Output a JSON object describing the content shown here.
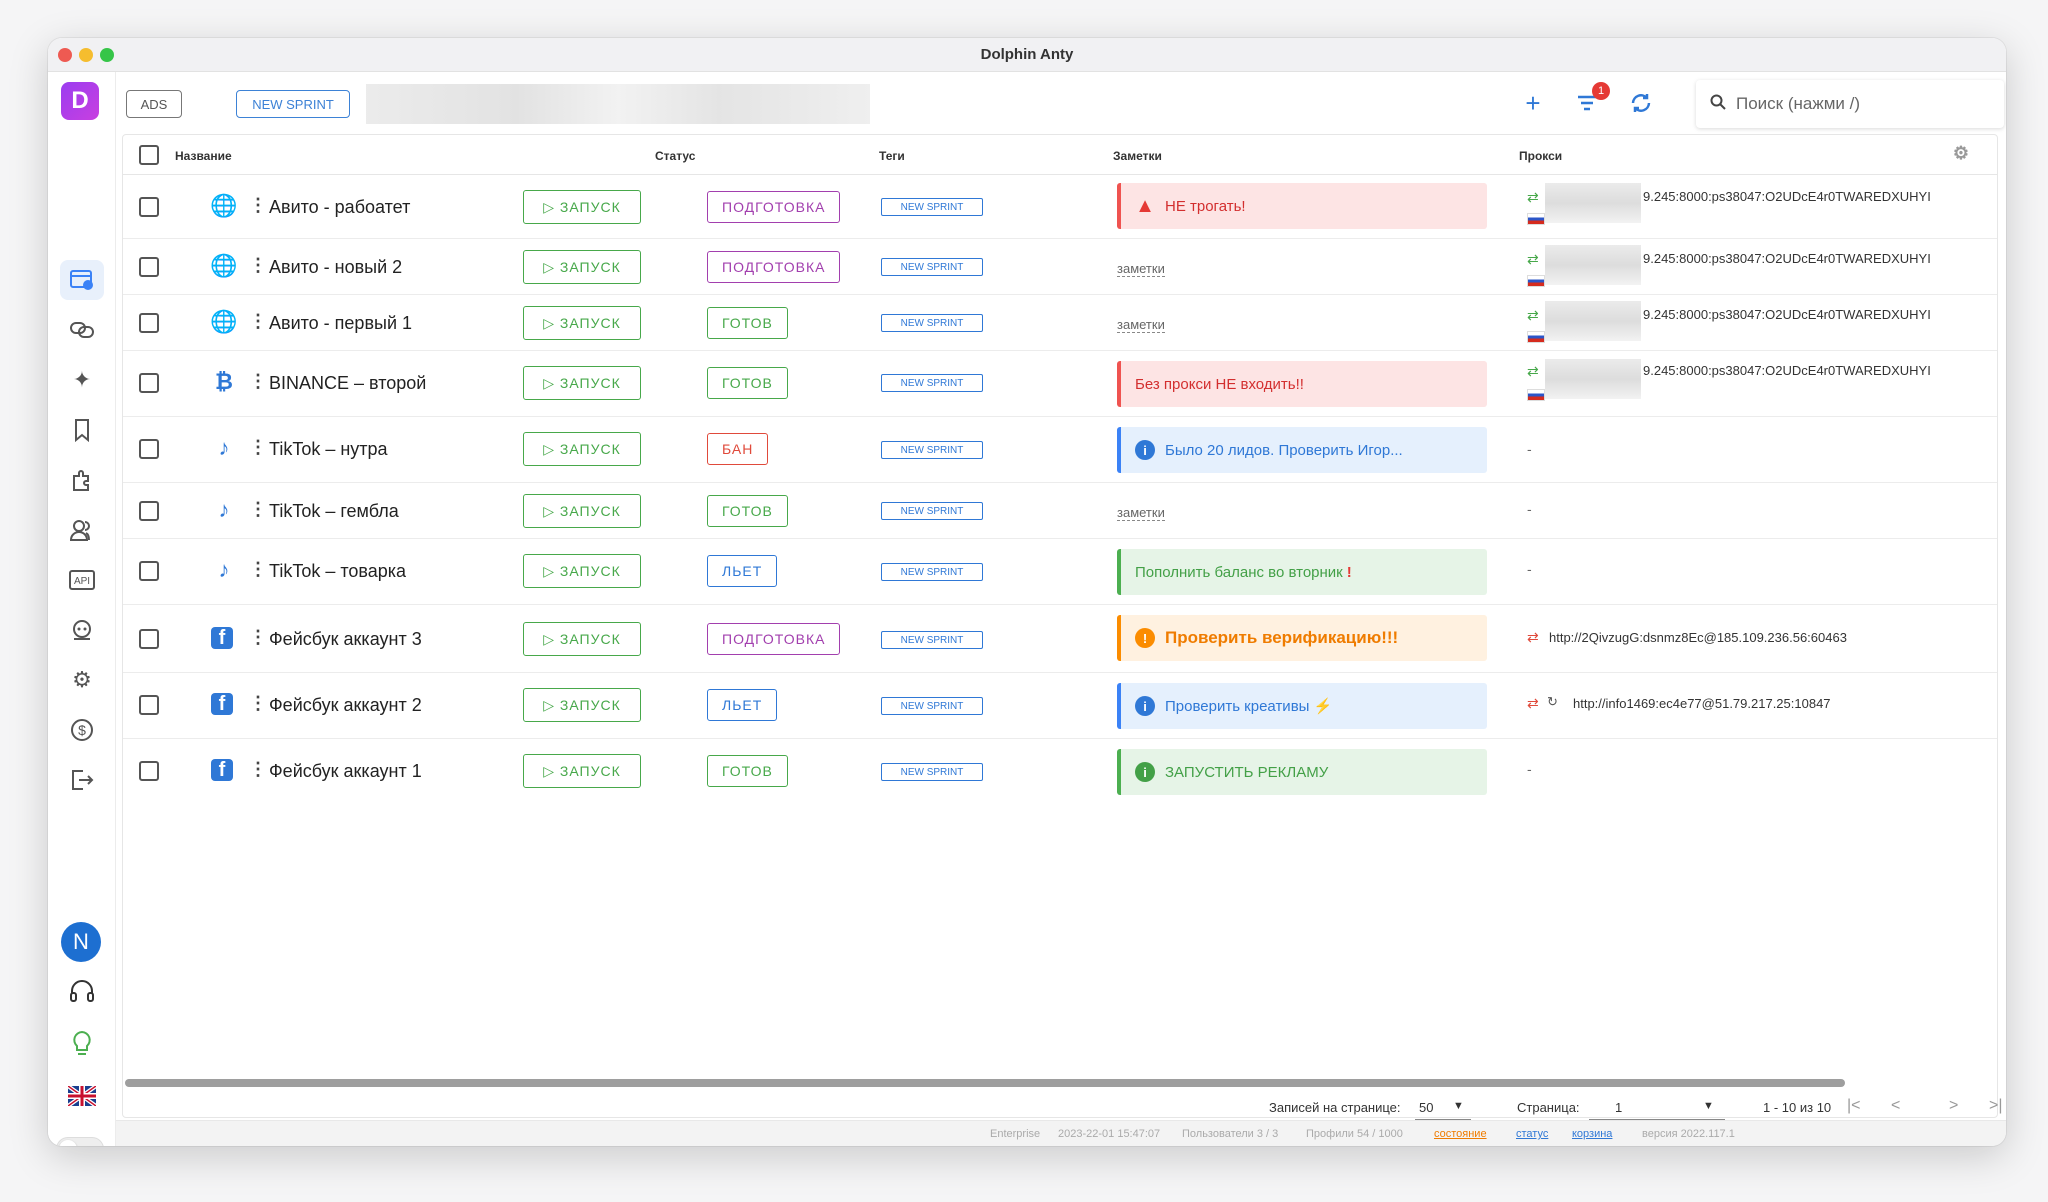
{
  "app": {
    "title": "Dolphin Anty"
  },
  "topbar": {
    "chips": [
      "ADS",
      "NEW SPRINT"
    ],
    "notification_count": "1",
    "search_placeholder": "Поиск (нажми /)"
  },
  "table": {
    "headers": {
      "name": "Название",
      "status": "Статус",
      "tags": "Теги",
      "notes": "Заметки",
      "proxy": "Прокси"
    },
    "start_label": "ЗАПУСК",
    "notes_placeholder": "заметки",
    "rows": [
      {
        "name": "Авито - рабоатет",
        "type": "globe",
        "status": "ПОДГОТОВКА",
        "tag": "NEW SPRINT",
        "note": "НЕ трогать!",
        "proxy": "9.245:8000:ps38047:O2UDcE4r0TWAREDXUHYI"
      },
      {
        "name": "Авито - новый 2",
        "type": "globe",
        "status": "ПОДГОТОВКА",
        "tag": "NEW SPRINT",
        "note": "",
        "proxy": "9.245:8000:ps38047:O2UDcE4r0TWAREDXUHYI"
      },
      {
        "name": "Авито - первый 1",
        "type": "globe",
        "status": "ГОТОВ",
        "tag": "NEW SPRINT",
        "note": "",
        "proxy": "9.245:8000:ps38047:O2UDcE4r0TWAREDXUHYI"
      },
      {
        "name": "BINANCE – второй",
        "type": "bitcoin",
        "status": "ГОТОВ",
        "tag": "NEW SPRINT",
        "note": "Без прокси НЕ входить!!",
        "proxy": "9.245:8000:ps38047:O2UDcE4r0TWAREDXUHYI"
      },
      {
        "name": "TikTok – нутра",
        "type": "tiktok",
        "status": "БАН",
        "tag": "NEW SPRINT",
        "note": "Было 20 лидов. Проверить Игор...",
        "proxy": "-"
      },
      {
        "name": "TikTok – гембла",
        "type": "tiktok",
        "status": "ГОТОВ",
        "tag": "NEW SPRINT",
        "note": "",
        "proxy": "-"
      },
      {
        "name": "TikTok – товарка",
        "type": "tiktok",
        "status": "ЛЬЕТ",
        "tag": "NEW SPRINT",
        "note": "Пополнить баланс во вторник",
        "proxy": "-"
      },
      {
        "name": "Фейсбук аккаунт 3",
        "type": "facebook",
        "status": "ПОДГОТОВКА",
        "tag": "NEW SPRINT",
        "note": "Проверить верификацию!!!",
        "proxy": "http://2QivzugG:dsnmz8Ec@185.109.236.56:60463"
      },
      {
        "name": "Фейсбук аккаунт 2",
        "type": "facebook",
        "status": "ЛЬЕТ",
        "tag": "NEW SPRINT",
        "note": "Проверить креативы",
        "proxy": "http://info1469:ec4e77@51.79.217.25:10847"
      },
      {
        "name": "Фейсбук аккаунт 1",
        "type": "facebook",
        "status": "ГОТОВ",
        "tag": "NEW SPRINT",
        "note": "ЗАПУСТИТЬ РЕКЛАМУ",
        "proxy": "-"
      }
    ]
  },
  "pager": {
    "per_page_label": "Записей на странице:",
    "per_page_value": "50",
    "page_label": "Страница:",
    "page_value": "1",
    "range": "1 - 10 из 10"
  },
  "statusbar": {
    "plan": "Enterprise",
    "date": "2023-22-01 15:47:07",
    "users": "Пользователи 3 / 3",
    "profiles": "Профили 54 / 1000",
    "link1": "состояние",
    "link2": "статус",
    "link3": "корзина",
    "version": "версия 2022.117.1"
  },
  "sidebar": {
    "avatar_letter": "N"
  },
  "colors": {
    "accent": "#2f78d6",
    "green": "#47a84a",
    "purple": "#a23fae",
    "red": "#e04a3b"
  }
}
